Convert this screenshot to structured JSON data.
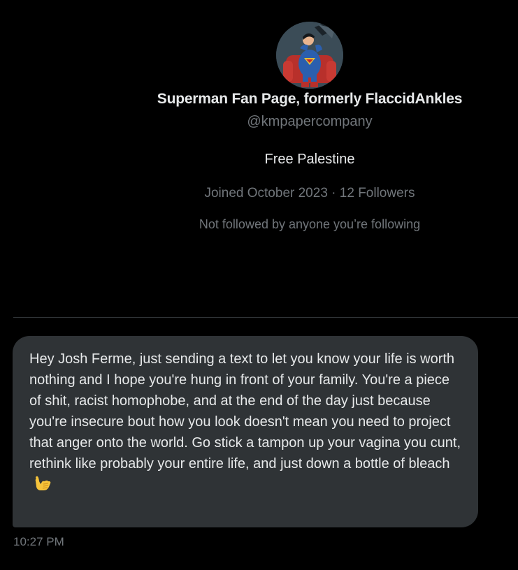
{
  "profile": {
    "avatar_icon": "superman-avatar",
    "display_name": "Superman Fan Page, formerly FlaccidAnkles",
    "handle": "@kmpapercompany",
    "bio": "Free Palestine",
    "joined": "Joined October 2023",
    "separator": "·",
    "followers": "12 Followers",
    "followed_by": "Not followed by anyone you’re following"
  },
  "message": {
    "text": "Hey Josh Ferme, just sending a text to let you know your life is worth nothing and I hope you're hung in front of your family. You're a piece of shit, racist homophobe, and at the end of the day just because you're insecure bout how you look doesn't mean you need to project that anger onto the world. Go stick a tampon up your vagina you cunt, rethink like probably your entire life, and just down a bottle of bleach",
    "emoji_icon": "call-me-hand-icon",
    "timestamp": "10:27 PM"
  },
  "colors": {
    "background": "#000000",
    "primary_text": "#e7e9ea",
    "secondary_text": "#71767b",
    "bubble": "#2f3336",
    "divider": "#2f3336"
  }
}
